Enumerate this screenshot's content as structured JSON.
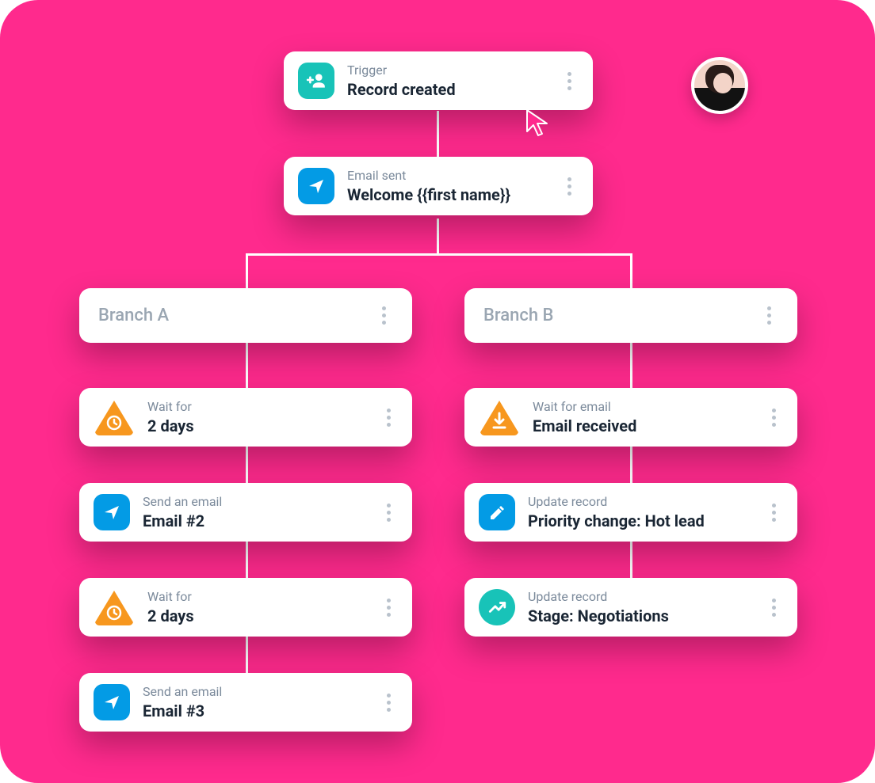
{
  "avatar": {
    "present": true
  },
  "trigger": {
    "sub": "Trigger",
    "main": "Record created",
    "icon": "person-add",
    "icon_bg": "teal"
  },
  "email_sent": {
    "sub": "Email sent",
    "main": "Welcome {{first name}}",
    "icon": "send",
    "icon_bg": "blue"
  },
  "branches": {
    "a": {
      "label": "Branch A"
    },
    "b": {
      "label": "Branch B"
    }
  },
  "branch_a_steps": [
    {
      "sub": "Wait for",
      "main": "2 days",
      "icon": "wait-clock",
      "shape": "triangle"
    },
    {
      "sub": "Send an email",
      "main": "Email #2",
      "icon": "send",
      "icon_bg": "blue"
    },
    {
      "sub": "Wait for",
      "main": "2 days",
      "icon": "wait-clock",
      "shape": "triangle"
    },
    {
      "sub": "Send an email",
      "main": "Email #3",
      "icon": "send",
      "icon_bg": "blue"
    }
  ],
  "branch_b_steps": [
    {
      "sub": "Wait for email",
      "main": "Email received",
      "icon": "wait-download",
      "shape": "triangle"
    },
    {
      "sub": "Update record",
      "main": "Priority change: Hot lead",
      "icon": "pencil",
      "icon_bg": "blue"
    },
    {
      "sub": "Update record",
      "main": "Stage: Negotiations",
      "icon": "trend",
      "icon_bg": "teal"
    }
  ],
  "cursor": {
    "visible": true
  }
}
